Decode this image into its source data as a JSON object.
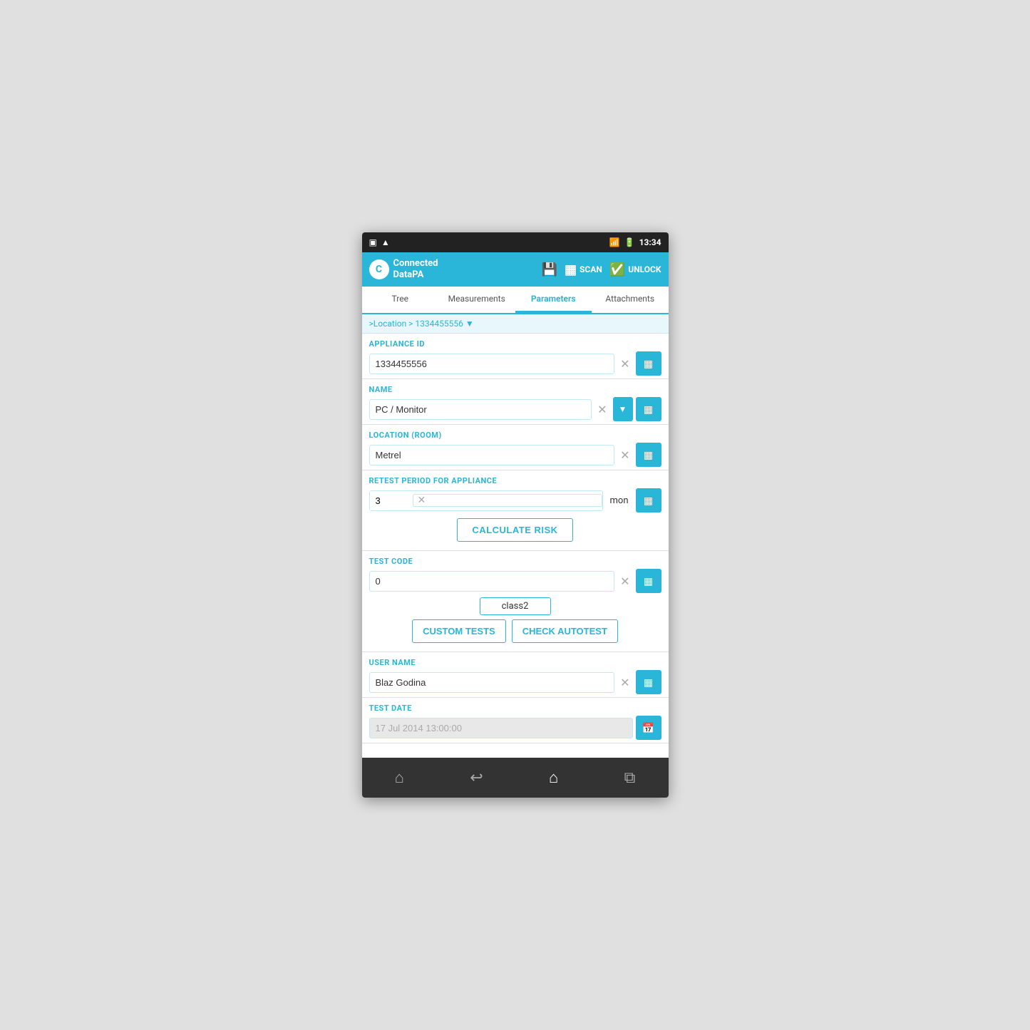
{
  "statusBar": {
    "leftIcons": [
      "▲",
      "▲"
    ],
    "rightIcons": [
      "wifi",
      "battery"
    ],
    "time": "13:34"
  },
  "header": {
    "logoText1": "Connected",
    "logoText2": "DataPA",
    "scanLabel": "SCAN",
    "unlockLabel": "UNLOCK"
  },
  "tabs": [
    {
      "label": "Tree",
      "active": false
    },
    {
      "label": "Measurements",
      "active": false
    },
    {
      "label": "Parameters",
      "active": true
    },
    {
      "label": "Attachments",
      "active": false
    }
  ],
  "breadcrumb": ">Location > 1334455556 ▼",
  "fields": {
    "applianceId": {
      "label": "APPLIANCE ID",
      "value": "1334455556",
      "placeholder": ""
    },
    "name": {
      "label": "NAME",
      "value": "PC / Monitor",
      "placeholder": ""
    },
    "location": {
      "label": "LOCATION (ROOM)",
      "value": "Metrel",
      "placeholder": ""
    },
    "retestPeriod": {
      "label": "RETEST PERIOD FOR APPLIANCE",
      "value": "3",
      "unit": "mon",
      "placeholder": ""
    },
    "calculateRiskBtn": "CALCULATE RISK",
    "testCode": {
      "label": "TEST CODE",
      "value": "0",
      "placeholder": ""
    },
    "classBadge": "class2",
    "customTestsBtn": "CUSTOM TESTS",
    "checkAutotestBtn": "CHECK AUTOTEST",
    "userName": {
      "label": "USER NAME",
      "value": "Blaz Godina",
      "placeholder": ""
    },
    "testDate": {
      "label": "TEST DATE",
      "value": "",
      "placeholder": "17 Jul 2014 13:00:00"
    }
  },
  "bottomNav": {
    "homeIcon": "⌂",
    "backIcon": "↩",
    "menuIcon": "☰",
    "appsIcon": "⧉"
  }
}
